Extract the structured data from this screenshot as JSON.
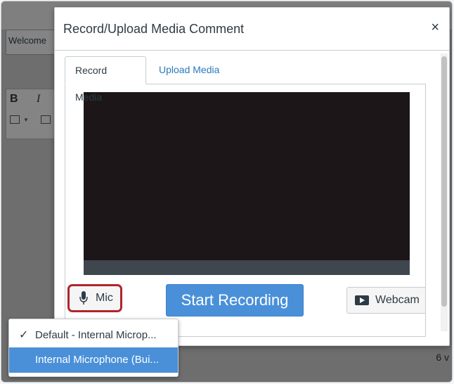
{
  "background": {
    "welcome_text": "Welcome",
    "bold_glyph": "B",
    "italic_glyph": "I",
    "bottom_text": "6 v"
  },
  "dialog": {
    "title": "Record/Upload Media Comment",
    "close_glyph": "×",
    "tabs": [
      {
        "label": "Record Media",
        "active": true
      },
      {
        "label": "Upload Media",
        "active": false
      }
    ]
  },
  "controls": {
    "mic_label": "Mic",
    "start_recording_label": "Start Recording",
    "webcam_label": "Webcam"
  },
  "mic_menu": {
    "items": [
      {
        "label": "Default - Internal Microp...",
        "selected": true,
        "highlighted": false
      },
      {
        "label": "Internal Microphone (Bui...",
        "selected": false,
        "highlighted": true
      }
    ]
  },
  "colors": {
    "primary_button": "#4a90d9",
    "link": "#2b7abc",
    "focus_outline": "#b2242c",
    "text": "#2d3b45",
    "video_background": "#1c1618"
  },
  "icons": {
    "mic": "microphone-icon",
    "webcam": "video-play-icon",
    "check": "checkmark-icon",
    "close": "close-icon"
  }
}
